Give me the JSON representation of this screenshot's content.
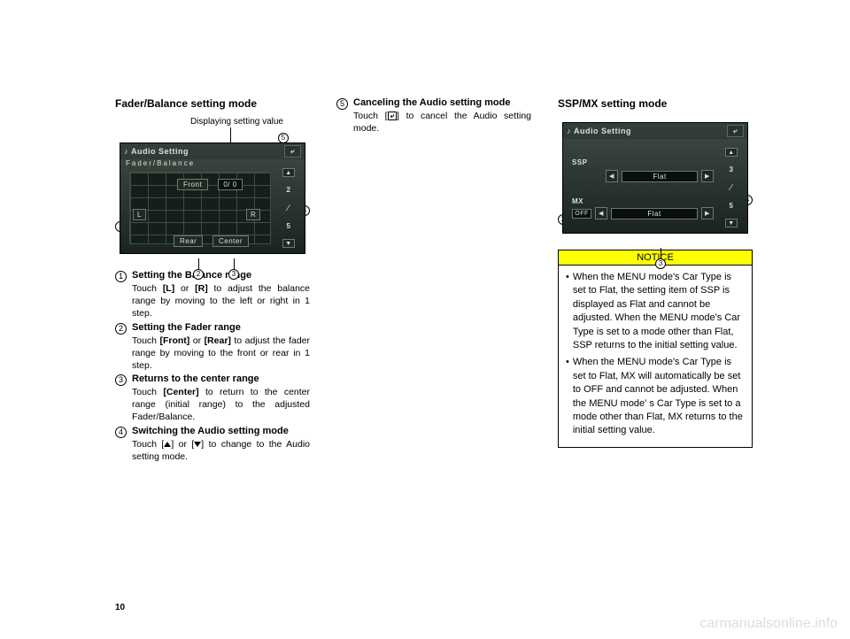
{
  "page_number": "10",
  "watermark": "carmanualsonline.info",
  "col1": {
    "heading": "Fader/Balance setting mode",
    "callout_label": "Displaying setting value",
    "screen": {
      "title": "Audio Setting",
      "subtitle": "Fader/Balance",
      "front": "Front",
      "rear": "Rear",
      "center": "Center",
      "left": "L",
      "right": "R",
      "value": "0/ 0",
      "side_num_top": "2",
      "side_num_bottom": "5"
    },
    "items": [
      {
        "num": "1",
        "title": "Setting the Balance range",
        "desc_pre": "Touch ",
        "desc_b1": "[L]",
        "desc_mid": " or ",
        "desc_b2": "[R]",
        "desc_post": " to adjust the balance range by moving to the left or right in 1 step."
      },
      {
        "num": "2",
        "title": "Setting the Fader range",
        "desc_pre": "Touch ",
        "desc_b1": "[Front]",
        "desc_mid": " or ",
        "desc_b2": "[Rear]",
        "desc_post": " to adjust the fader range by moving to the front or rear in 1 step."
      },
      {
        "num": "3",
        "title": "Returns to the center range",
        "desc_pre": "Touch ",
        "desc_b1": "[Center]",
        "desc_mid": "",
        "desc_b2": "",
        "desc_post": " to return to the center range (initial range) to the adjusted Fader/Balance."
      },
      {
        "num": "4",
        "title": "Switching the Audio setting mode",
        "desc_pre": "Touch [",
        "desc_mid_triangles": true,
        "desc_post": "  to change to the Audio setting mode."
      }
    ]
  },
  "col2": {
    "item": {
      "num": "5",
      "title": "Canceling the Audio setting mode",
      "desc_pre": "Touch [",
      "desc_icon": "↵",
      "desc_post": "] to cancel the Audio setting mode."
    }
  },
  "col3": {
    "heading": "SSP/MX setting mode",
    "screen": {
      "title": "Audio Setting",
      "ssp_label": "SSP",
      "ssp_value": "Flat",
      "mx_label": "MX",
      "mx_off": "OFF",
      "mx_value": "Flat",
      "side_num_top": "3",
      "side_num_bottom": "5"
    },
    "notice_title": "NOTICE",
    "notice_bullets": [
      "When the MENU mode's  Car Type is  set to Flat, the setting item of SSP is displayed as Flat and cannot be adjusted. When the MENU mode's Car Type is set to a mode other than Flat, SSP returns to the initial setting value.",
      "When the MENU mode's Car Type is set to Flat, MX will automatically be set to OFF and cannot be adjusted.  When the MENU mode' s Car  Type  is set to a mode other than Flat, MX returns to the initial setting value."
    ]
  }
}
